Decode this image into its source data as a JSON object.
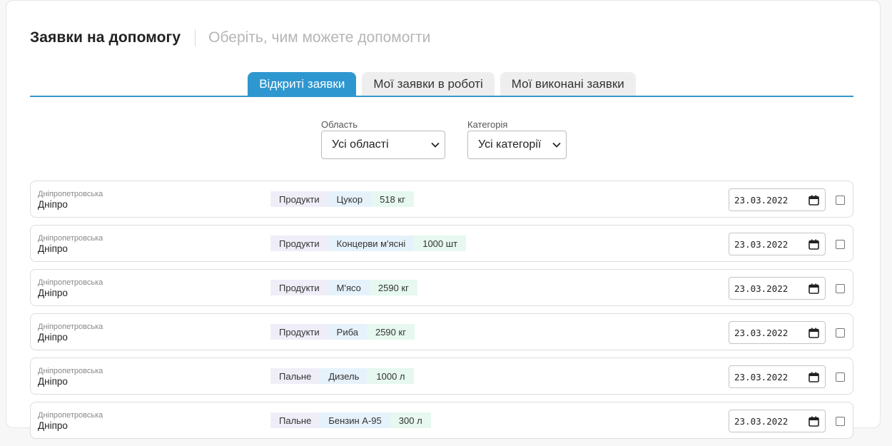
{
  "header": {
    "title": "Заявки на допомогу",
    "subtitle": "Оберіть, чим можете допомогти"
  },
  "tabs": [
    {
      "label": "Відкриті заявки",
      "active": true
    },
    {
      "label": "Мої заявки в роботі",
      "active": false
    },
    {
      "label": "Мої виконані заявки",
      "active": false
    }
  ],
  "filters": {
    "region": {
      "label": "Область",
      "value": "Усі області"
    },
    "category": {
      "label": "Категорія",
      "value": "Усі категорії"
    }
  },
  "requests": [
    {
      "region": "Дніпропетровська",
      "city": "Дніпро",
      "category": "Продукти",
      "item": "Цукор",
      "amount": "518 кг",
      "date": "23.03.2022"
    },
    {
      "region": "Дніпропетровська",
      "city": "Дніпро",
      "category": "Продукти",
      "item": "Концерви м'ясні",
      "amount": "1000 шт",
      "date": "23.03.2022"
    },
    {
      "region": "Дніпропетровська",
      "city": "Дніпро",
      "category": "Продукти",
      "item": "М'ясо",
      "amount": "2590 кг",
      "date": "23.03.2022"
    },
    {
      "region": "Дніпропетровська",
      "city": "Дніпро",
      "category": "Продукти",
      "item": "Риба",
      "amount": "2590 кг",
      "date": "23.03.2022"
    },
    {
      "region": "Дніпропетровська",
      "city": "Дніпро",
      "category": "Пальне",
      "item": "Дизель",
      "amount": "1000 л",
      "date": "23.03.2022"
    },
    {
      "region": "Дніпропетровська",
      "city": "Дніпро",
      "category": "Пальне",
      "item": "Бензин А-95",
      "amount": "300 л",
      "date": "23.03.2022"
    }
  ],
  "colors": {
    "accent": "#2f97d0",
    "tag_category": "#efeef8",
    "tag_item": "#e6f2fb",
    "tag_amount": "#e6f8ef"
  },
  "icons": {
    "dropdown": "chevron-down-icon",
    "date": "calendar-icon"
  }
}
